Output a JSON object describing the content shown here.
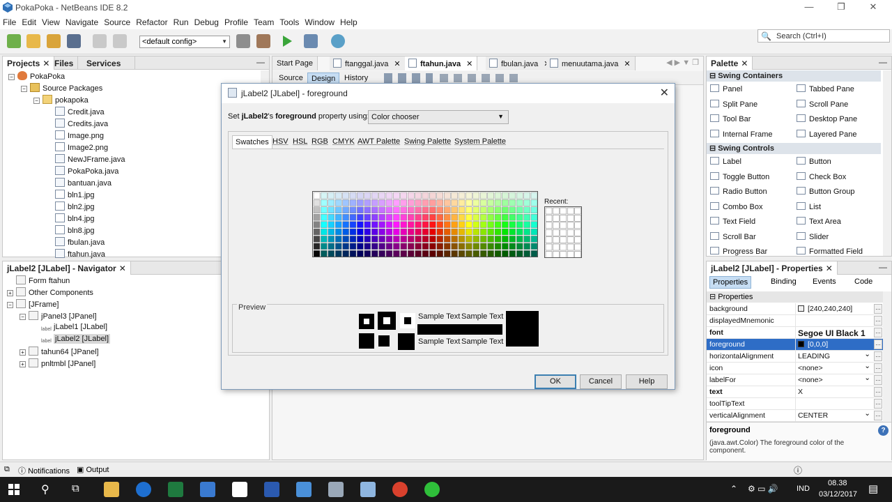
{
  "window": {
    "title": "PokaPoka - NetBeans IDE 8.2",
    "minimize": "—",
    "restore": "❐",
    "close": "✕"
  },
  "menu": [
    "File",
    "Edit",
    "View",
    "Navigate",
    "Source",
    "Refactor",
    "Run",
    "Debug",
    "Profile",
    "Team",
    "Tools",
    "Window",
    "Help"
  ],
  "toolbar": {
    "config": "<default config>",
    "search_placeholder": "Search (Ctrl+I)"
  },
  "projects_panel": {
    "tabs": [
      "Projects",
      "Files",
      "Services"
    ],
    "tree": [
      {
        "label": "PokaPoka",
        "type": "proj",
        "level": 0,
        "exp": "−"
      },
      {
        "label": "Source Packages",
        "type": "folder",
        "level": 1,
        "exp": "−"
      },
      {
        "label": "pokapoka",
        "type": "pkg",
        "level": 2,
        "exp": "−"
      },
      {
        "label": "Credit.java",
        "type": "java",
        "level": 3
      },
      {
        "label": "Credits.java",
        "type": "java",
        "level": 3
      },
      {
        "label": "Image.png",
        "type": "file",
        "level": 3
      },
      {
        "label": "Image2.png",
        "type": "file",
        "level": 3
      },
      {
        "label": "NewJFrame.java",
        "type": "java",
        "level": 3
      },
      {
        "label": "PokaPoka.java",
        "type": "java",
        "level": 3
      },
      {
        "label": "bantuan.java",
        "type": "java",
        "level": 3
      },
      {
        "label": "bln1.jpg",
        "type": "file",
        "level": 3
      },
      {
        "label": "bln2.jpg",
        "type": "file",
        "level": 3
      },
      {
        "label": "bln4.jpg",
        "type": "file",
        "level": 3
      },
      {
        "label": "bln8.jpg",
        "type": "file",
        "level": 3
      },
      {
        "label": "fbulan.java",
        "type": "java",
        "level": 3
      },
      {
        "label": "ftahun.java",
        "type": "java",
        "level": 3
      }
    ]
  },
  "navigator_panel": {
    "title": "jLabel2 [JLabel] - Navigator",
    "tree": [
      {
        "label": "Form ftahun",
        "level": 0,
        "icon": "frame"
      },
      {
        "label": "Other Components",
        "level": 0,
        "icon": "frame",
        "exp": "+"
      },
      {
        "label": "[JFrame]",
        "level": 0,
        "icon": "frame",
        "exp": "−"
      },
      {
        "label": "jPanel3 [JPanel]",
        "level": 1,
        "icon": "frame",
        "exp": "−"
      },
      {
        "label": "jLabel1 [JLabel]",
        "level": 2,
        "icon": "label"
      },
      {
        "label": "jLabel2 [JLabel]",
        "level": 2,
        "icon": "label",
        "selected": true
      },
      {
        "label": "tahun64 [JPanel]",
        "level": 1,
        "icon": "frame",
        "exp": "+"
      },
      {
        "label": "pnltmbl [JPanel]",
        "level": 1,
        "icon": "frame",
        "exp": "+"
      }
    ]
  },
  "editor": {
    "tabs": [
      {
        "label": "Start Page",
        "active": false
      },
      {
        "label": "ftanggal.java",
        "active": false
      },
      {
        "label": "ftahun.java",
        "active": true
      },
      {
        "label": "fbulan.java",
        "active": false
      },
      {
        "label": "menuutama.java",
        "active": false
      }
    ],
    "subtabs": [
      {
        "label": "Source",
        "active": false
      },
      {
        "label": "Design",
        "active": true
      },
      {
        "label": "History",
        "active": false
      }
    ]
  },
  "dialog": {
    "title": "jLabel2 [JLabel] - foreground",
    "set_prefix": "Set ",
    "set_bold1": "jLabel2",
    "set_mid": "'s ",
    "set_bold2": "foreground",
    "set_suffix": " property using:",
    "chooser": "Color chooser",
    "tabs": [
      "Swatches",
      "HSV",
      "HSL",
      "RGB",
      "CMYK",
      "AWT Palette",
      "Swing Palette",
      "System Palette"
    ],
    "recent_label": "Recent:",
    "preview_label": "Preview",
    "sample_text": "Sample Text",
    "buttons": {
      "ok": "OK",
      "cancel": "Cancel",
      "help": "Help"
    }
  },
  "palette_panel": {
    "title": "Palette",
    "sections": [
      {
        "name": "Swing Containers",
        "items": [
          "Panel",
          "Tabbed Pane",
          "Split Pane",
          "Scroll Pane",
          "Tool Bar",
          "Desktop Pane",
          "Internal Frame",
          "Layered Pane"
        ]
      },
      {
        "name": "Swing Controls",
        "items": [
          "Label",
          "Button",
          "Toggle Button",
          "Check Box",
          "Radio Button",
          "Button Group",
          "Combo Box",
          "List",
          "Text Field",
          "Text Area",
          "Scroll Bar",
          "Slider",
          "Progress Bar",
          "Formatted Field"
        ]
      }
    ]
  },
  "properties_panel": {
    "title": "jLabel2 [JLabel] - Properties",
    "tabs": [
      "Properties",
      "Binding",
      "Events",
      "Code"
    ],
    "section": "Properties",
    "rows": [
      {
        "key": "background",
        "value": "[240,240,240]",
        "swatch": "#f0f0f0"
      },
      {
        "key": "displayedMnemonic",
        "value": ""
      },
      {
        "key": "font",
        "value": "Segoe UI Black 1",
        "bold": true
      },
      {
        "key": "foreground",
        "value": "[0,0,0]",
        "swatch": "#000000",
        "selected": true
      },
      {
        "key": "horizontalAlignment",
        "value": "LEADING",
        "dropdown": true
      },
      {
        "key": "icon",
        "value": "<none>",
        "dropdown": true
      },
      {
        "key": "labelFor",
        "value": "<none>",
        "dropdown": true
      },
      {
        "key": "text",
        "value": "X",
        "bold": true
      },
      {
        "key": "toolTipText",
        "value": ""
      },
      {
        "key": "verticalAlignment",
        "value": "CENTER",
        "dropdown": true
      }
    ],
    "help_title": "foreground",
    "help_text": "(java.awt.Color) The foreground color of the component."
  },
  "statusbar": {
    "notifications": "Notifications",
    "output": "Output"
  },
  "taskbar": {
    "language": "IND",
    "time": "08.38",
    "date": "03/12/2017"
  },
  "colors": {
    "accent": "#3399ff",
    "selection": "#2e6dc6",
    "active_tab": "#c6ddf3"
  }
}
